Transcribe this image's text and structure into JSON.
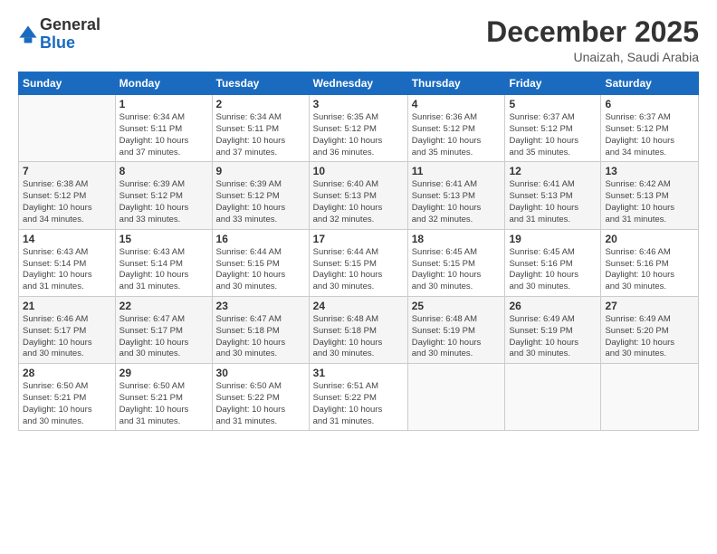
{
  "logo": {
    "general": "General",
    "blue": "Blue"
  },
  "header": {
    "month": "December 2025",
    "location": "Unaizah, Saudi Arabia"
  },
  "weekdays": [
    "Sunday",
    "Monday",
    "Tuesday",
    "Wednesday",
    "Thursday",
    "Friday",
    "Saturday"
  ],
  "weeks": [
    [
      {
        "day": "",
        "info": ""
      },
      {
        "day": "1",
        "info": "Sunrise: 6:34 AM\nSunset: 5:11 PM\nDaylight: 10 hours\nand 37 minutes."
      },
      {
        "day": "2",
        "info": "Sunrise: 6:34 AM\nSunset: 5:11 PM\nDaylight: 10 hours\nand 37 minutes."
      },
      {
        "day": "3",
        "info": "Sunrise: 6:35 AM\nSunset: 5:12 PM\nDaylight: 10 hours\nand 36 minutes."
      },
      {
        "day": "4",
        "info": "Sunrise: 6:36 AM\nSunset: 5:12 PM\nDaylight: 10 hours\nand 35 minutes."
      },
      {
        "day": "5",
        "info": "Sunrise: 6:37 AM\nSunset: 5:12 PM\nDaylight: 10 hours\nand 35 minutes."
      },
      {
        "day": "6",
        "info": "Sunrise: 6:37 AM\nSunset: 5:12 PM\nDaylight: 10 hours\nand 34 minutes."
      }
    ],
    [
      {
        "day": "7",
        "info": "Sunrise: 6:38 AM\nSunset: 5:12 PM\nDaylight: 10 hours\nand 34 minutes."
      },
      {
        "day": "8",
        "info": "Sunrise: 6:39 AM\nSunset: 5:12 PM\nDaylight: 10 hours\nand 33 minutes."
      },
      {
        "day": "9",
        "info": "Sunrise: 6:39 AM\nSunset: 5:12 PM\nDaylight: 10 hours\nand 33 minutes."
      },
      {
        "day": "10",
        "info": "Sunrise: 6:40 AM\nSunset: 5:13 PM\nDaylight: 10 hours\nand 32 minutes."
      },
      {
        "day": "11",
        "info": "Sunrise: 6:41 AM\nSunset: 5:13 PM\nDaylight: 10 hours\nand 32 minutes."
      },
      {
        "day": "12",
        "info": "Sunrise: 6:41 AM\nSunset: 5:13 PM\nDaylight: 10 hours\nand 31 minutes."
      },
      {
        "day": "13",
        "info": "Sunrise: 6:42 AM\nSunset: 5:13 PM\nDaylight: 10 hours\nand 31 minutes."
      }
    ],
    [
      {
        "day": "14",
        "info": "Sunrise: 6:43 AM\nSunset: 5:14 PM\nDaylight: 10 hours\nand 31 minutes."
      },
      {
        "day": "15",
        "info": "Sunrise: 6:43 AM\nSunset: 5:14 PM\nDaylight: 10 hours\nand 31 minutes."
      },
      {
        "day": "16",
        "info": "Sunrise: 6:44 AM\nSunset: 5:15 PM\nDaylight: 10 hours\nand 30 minutes."
      },
      {
        "day": "17",
        "info": "Sunrise: 6:44 AM\nSunset: 5:15 PM\nDaylight: 10 hours\nand 30 minutes."
      },
      {
        "day": "18",
        "info": "Sunrise: 6:45 AM\nSunset: 5:15 PM\nDaylight: 10 hours\nand 30 minutes."
      },
      {
        "day": "19",
        "info": "Sunrise: 6:45 AM\nSunset: 5:16 PM\nDaylight: 10 hours\nand 30 minutes."
      },
      {
        "day": "20",
        "info": "Sunrise: 6:46 AM\nSunset: 5:16 PM\nDaylight: 10 hours\nand 30 minutes."
      }
    ],
    [
      {
        "day": "21",
        "info": "Sunrise: 6:46 AM\nSunset: 5:17 PM\nDaylight: 10 hours\nand 30 minutes."
      },
      {
        "day": "22",
        "info": "Sunrise: 6:47 AM\nSunset: 5:17 PM\nDaylight: 10 hours\nand 30 minutes."
      },
      {
        "day": "23",
        "info": "Sunrise: 6:47 AM\nSunset: 5:18 PM\nDaylight: 10 hours\nand 30 minutes."
      },
      {
        "day": "24",
        "info": "Sunrise: 6:48 AM\nSunset: 5:18 PM\nDaylight: 10 hours\nand 30 minutes."
      },
      {
        "day": "25",
        "info": "Sunrise: 6:48 AM\nSunset: 5:19 PM\nDaylight: 10 hours\nand 30 minutes."
      },
      {
        "day": "26",
        "info": "Sunrise: 6:49 AM\nSunset: 5:19 PM\nDaylight: 10 hours\nand 30 minutes."
      },
      {
        "day": "27",
        "info": "Sunrise: 6:49 AM\nSunset: 5:20 PM\nDaylight: 10 hours\nand 30 minutes."
      }
    ],
    [
      {
        "day": "28",
        "info": "Sunrise: 6:50 AM\nSunset: 5:21 PM\nDaylight: 10 hours\nand 30 minutes."
      },
      {
        "day": "29",
        "info": "Sunrise: 6:50 AM\nSunset: 5:21 PM\nDaylight: 10 hours\nand 31 minutes."
      },
      {
        "day": "30",
        "info": "Sunrise: 6:50 AM\nSunset: 5:22 PM\nDaylight: 10 hours\nand 31 minutes."
      },
      {
        "day": "31",
        "info": "Sunrise: 6:51 AM\nSunset: 5:22 PM\nDaylight: 10 hours\nand 31 minutes."
      },
      {
        "day": "",
        "info": ""
      },
      {
        "day": "",
        "info": ""
      },
      {
        "day": "",
        "info": ""
      }
    ]
  ]
}
